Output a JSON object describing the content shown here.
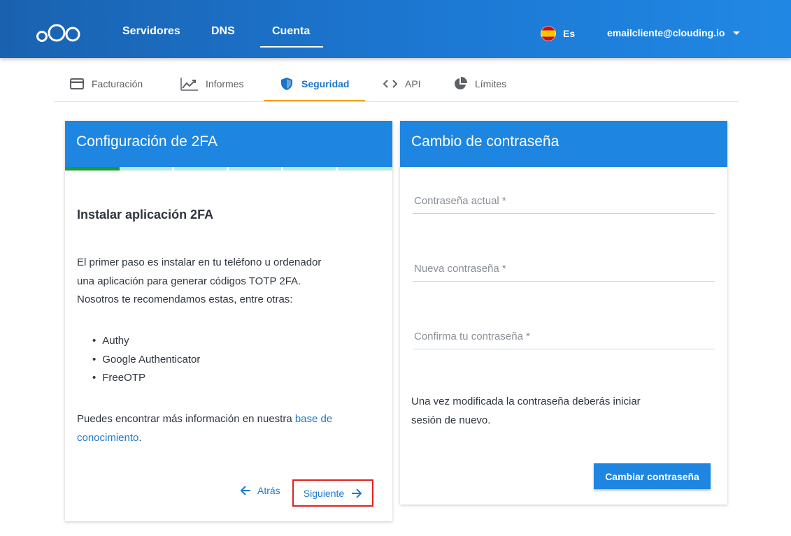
{
  "header": {
    "nav": [
      {
        "label": "Servidores"
      },
      {
        "label": "DNS"
      },
      {
        "label": "Cuenta"
      }
    ],
    "language": "Es",
    "user_email": "emailcliente@clouding.io"
  },
  "subtabs": [
    {
      "label": "Facturación",
      "icon": "credit-card-icon"
    },
    {
      "label": "Informes",
      "icon": "chart-line-icon"
    },
    {
      "label": "Seguridad",
      "icon": "shield-icon"
    },
    {
      "label": "API",
      "icon": "code-icon"
    },
    {
      "label": "Límites",
      "icon": "pie-chart-icon"
    }
  ],
  "twofa": {
    "title": "Configuración de 2FA",
    "progress_fraction": 0.1667,
    "step_title": "Instalar aplicación 2FA",
    "intro_line1": "El primer paso es instalar en tu teléfono u ordenador",
    "intro_line2": "una aplicación para generar códigos TOTP 2FA.",
    "intro_line3": "Nosotros te recomendamos estas, entre otras:",
    "apps": [
      "Authy",
      "Google Authenticator",
      "FreeOTP"
    ],
    "info_text": "Puedes encontrar más información en nuestra ",
    "link_part1": "base de",
    "link_part2": "conocimiento",
    "info_end": ".",
    "back_label": "Atrás",
    "next_label": "Siguiente"
  },
  "password": {
    "title": "Cambio de contraseña",
    "current_placeholder": "Contraseña actual *",
    "new_placeholder": "Nueva contraseña *",
    "confirm_placeholder": "Confirma tu contraseña *",
    "note_line1": "Una vez modificada la contraseña deberás iniciar",
    "note_line2": "sesión de nuevo.",
    "submit_label": "Cambiar contraseña"
  },
  "colors": {
    "header_blue": "#1c78d3",
    "accent_blue": "#1e86e1",
    "tab_underline": "#f0a020",
    "progress_done": "#1a9e2f",
    "progress_todo": "#b7eadb",
    "highlight_red": "#e0211d"
  }
}
